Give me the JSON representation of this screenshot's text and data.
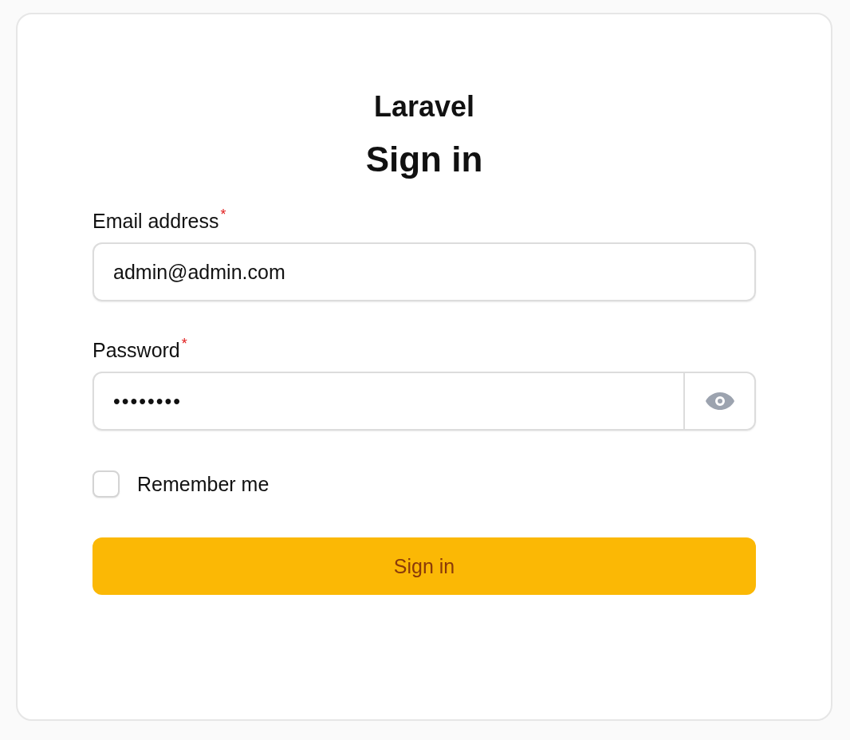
{
  "brand": "Laravel",
  "heading": "Sign in",
  "fields": [
    {
      "kind": "text",
      "label": "Email address",
      "required_mark": "*",
      "value": "admin@admin.com"
    },
    {
      "kind": "password",
      "label": "Password",
      "required_mark": "*",
      "value": "••••••••"
    }
  ],
  "remember": {
    "label": "Remember me",
    "checked": false
  },
  "submit": {
    "label": "Sign in"
  }
}
